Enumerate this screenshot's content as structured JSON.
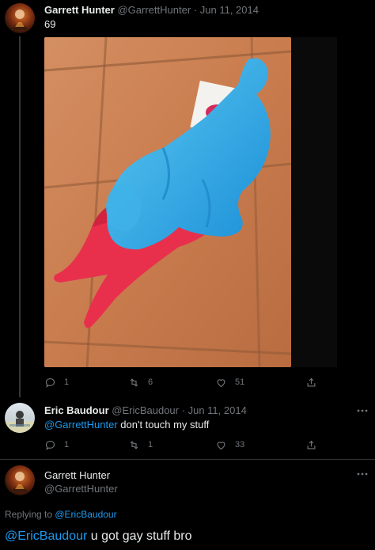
{
  "tweets": [
    {
      "name": "Garrett Hunter",
      "handle": "@GarrettHunter",
      "date": "Jun 11, 2014",
      "text": "69",
      "replies": "1",
      "retweets": "6",
      "likes": "51"
    },
    {
      "name": "Eric Baudour",
      "handle": "@EricBaudour",
      "date": "Jun 11, 2014",
      "mention": "@GarrettHunter",
      "text": " don't touch my stuff",
      "replies": "1",
      "retweets": "1",
      "likes": "33"
    }
  ],
  "focused": {
    "name": "Garrett Hunter",
    "handle": "@GarrettHunter",
    "replying_prefix": "Replying to ",
    "replying_to": "@EricBaudour",
    "mention": "@EricBaudour",
    "text": " u got gay stuff bro"
  },
  "colors": {
    "background": "#000000",
    "accent": "#1d9bf0",
    "secondary_text": "#71767b"
  },
  "icons": [
    "reply-icon",
    "retweet-icon",
    "like-icon",
    "share-icon",
    "more-icon"
  ]
}
